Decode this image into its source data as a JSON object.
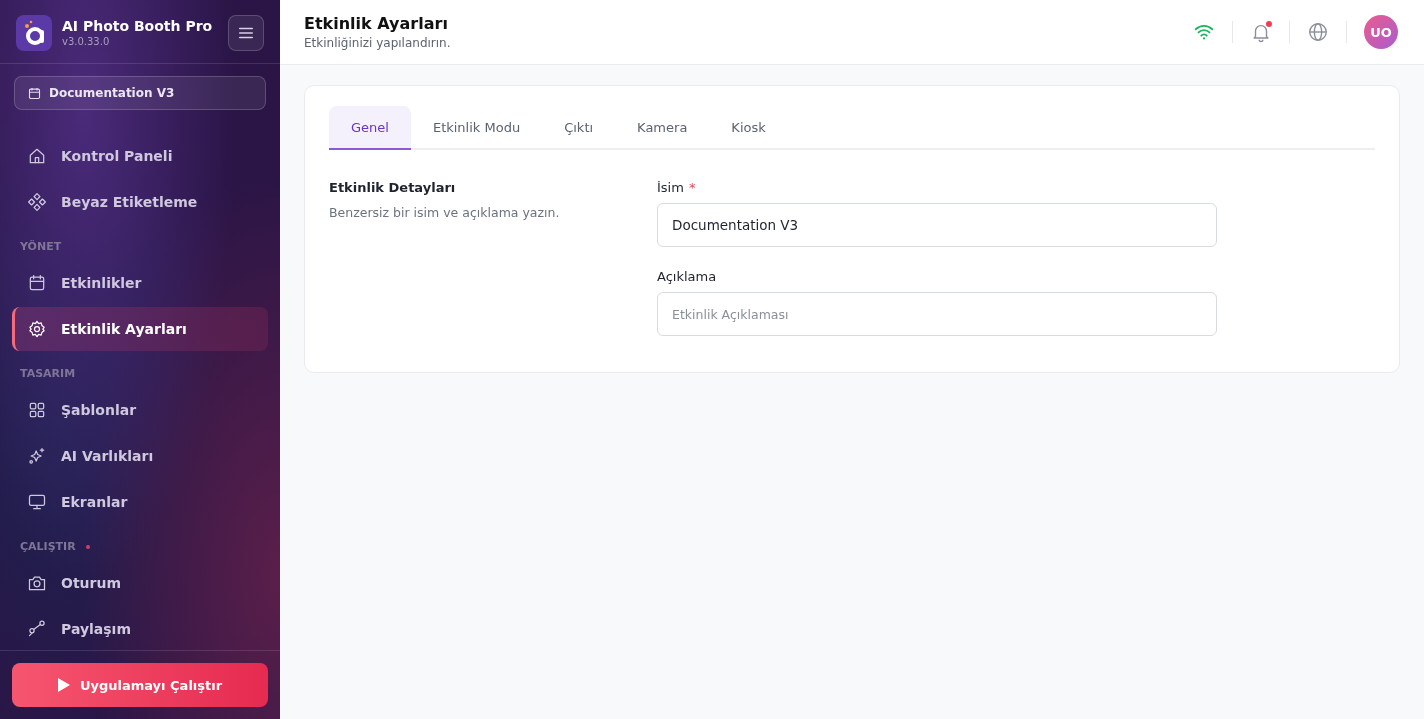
{
  "app": {
    "name": "AI Photo Booth Pro",
    "version": "v3.0.33.0"
  },
  "event_selector": {
    "label": "Documentation V3"
  },
  "sidebar": {
    "items": [
      {
        "kind": "item",
        "label": "Kontrol Paneli",
        "selected": false
      },
      {
        "kind": "item",
        "label": "Beyaz Etiketleme",
        "selected": false
      },
      {
        "kind": "section",
        "label": "YÖNET",
        "dot": false
      },
      {
        "kind": "item",
        "label": "Etkinlikler",
        "selected": false
      },
      {
        "kind": "item",
        "label": "Etkinlik Ayarları",
        "selected": true
      },
      {
        "kind": "section",
        "label": "TASARIM",
        "dot": false
      },
      {
        "kind": "item",
        "label": "Şablonlar",
        "selected": false
      },
      {
        "kind": "item",
        "label": "AI Varlıkları",
        "selected": false
      },
      {
        "kind": "item",
        "label": "Ekranlar",
        "selected": false
      },
      {
        "kind": "section",
        "label": "ÇALIŞTIR",
        "dot": true
      },
      {
        "kind": "item",
        "label": "Oturum",
        "selected": false
      },
      {
        "kind": "item",
        "label": "Paylaşım",
        "selected": false
      }
    ]
  },
  "run_button": {
    "label": "Uygulamayı Çalıştır"
  },
  "header": {
    "title": "Etkinlik Ayarları",
    "subtitle": "Etkinliğinizi yapılandırın.",
    "notification_unread": true,
    "avatar": "UO"
  },
  "tabs": [
    {
      "label": "Genel",
      "selected": true
    },
    {
      "label": "Etkinlik Modu",
      "selected": false
    },
    {
      "label": "Çıktı",
      "selected": false
    },
    {
      "label": "Kamera",
      "selected": false
    },
    {
      "label": "Kiosk",
      "selected": false
    }
  ],
  "section": {
    "title": "Etkinlik Detayları",
    "description": "Benzersiz bir isim ve açıklama yazın."
  },
  "fields": [
    {
      "label": "İsim",
      "required_mark": "*",
      "value": "Documentation V3"
    },
    {
      "label": "Açıklama",
      "placeholder": "Etkinlik Açıklaması"
    }
  ]
}
